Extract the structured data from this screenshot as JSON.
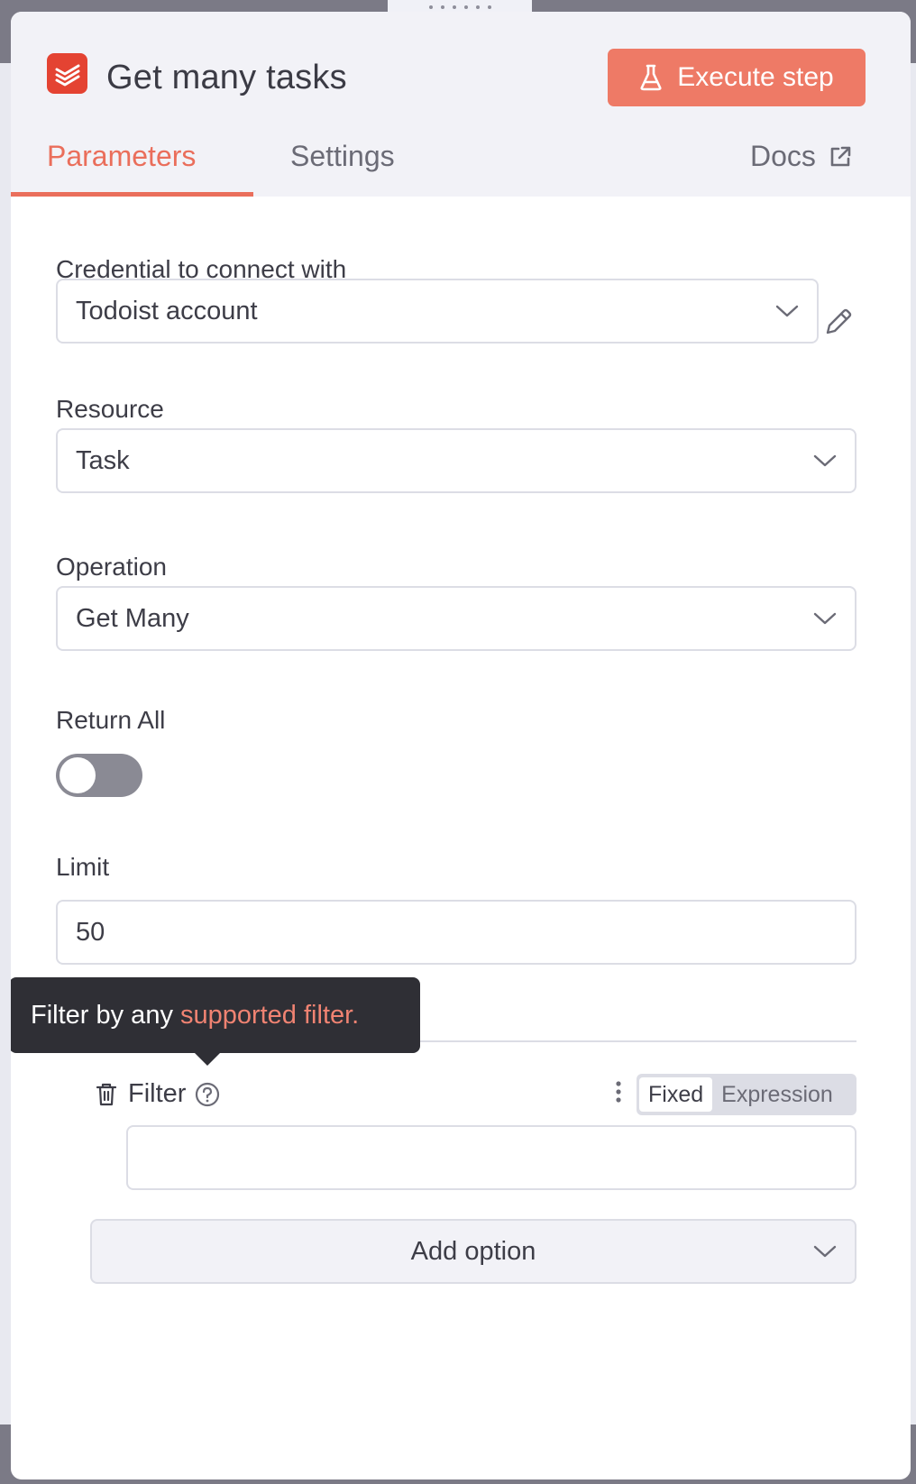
{
  "node": {
    "title": "Get many tasks",
    "icon": "todoist-icon",
    "brand_color": "#e44332"
  },
  "toolbar": {
    "execute_label": "Execute step",
    "execute_icon": "flask-icon",
    "accent_color": "#ee7a66"
  },
  "tabs": [
    {
      "label": "Parameters",
      "active": true
    },
    {
      "label": "Settings",
      "active": false
    }
  ],
  "docs": {
    "label": "Docs",
    "icon": "external-link-icon"
  },
  "fields": {
    "credential": {
      "label": "Credential to connect with",
      "value": "Todoist account"
    },
    "resource": {
      "label": "Resource",
      "value": "Task"
    },
    "operation": {
      "label": "Operation",
      "value": "Get Many"
    },
    "return_all": {
      "label": "Return All",
      "enabled": false
    },
    "limit": {
      "label": "Limit",
      "value": "50"
    }
  },
  "tooltip": {
    "text": "Filter by any",
    "link_text": "supported filter."
  },
  "filter": {
    "label": "Filter",
    "mode_fixed": "Fixed",
    "mode_expression": "Expression",
    "value": ""
  },
  "add_option": {
    "label": "Add option"
  }
}
